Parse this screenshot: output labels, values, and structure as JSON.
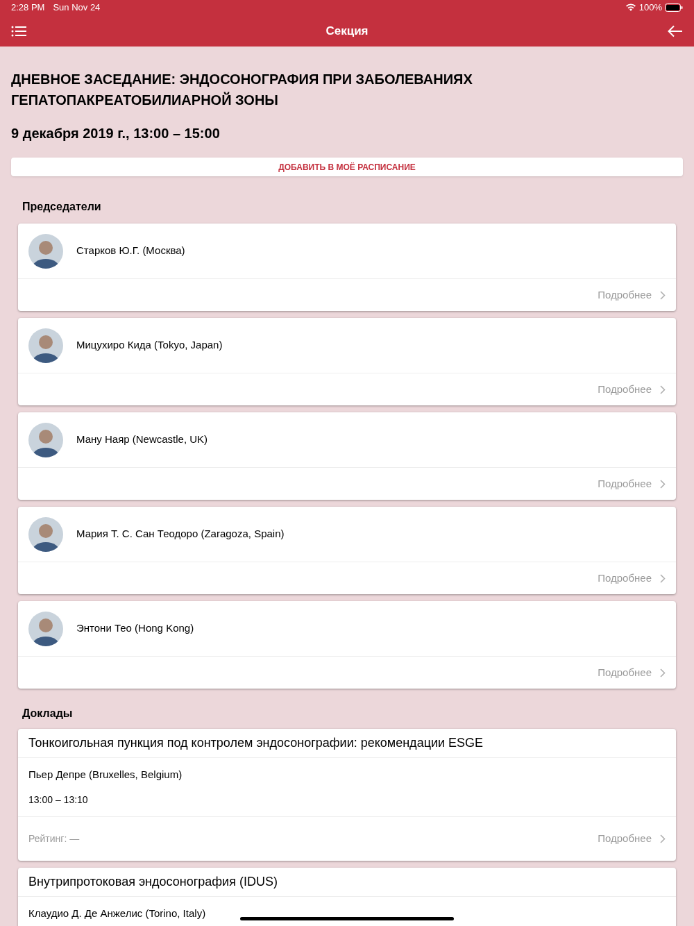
{
  "status_bar": {
    "time": "2:28 PM",
    "date": "Sun Nov 24",
    "battery": "100%"
  },
  "nav": {
    "title": "Секция"
  },
  "session": {
    "title": "ДНЕВНОЕ ЗАСЕДАНИЕ: ЭНДОСОНОГРАФИЯ ПРИ ЗАБОЛЕВАНИЯХ ГЕПАТОПАКРЕАТОБИЛИАРНОЙ ЗОНЫ",
    "datetime": "9 декабря 2019 г., 13:00 – 15:00",
    "add_button": "ДОБАВИТЬ В МОЁ РАСПИСАНИЕ"
  },
  "chairs": {
    "heading": "Председатели",
    "items": [
      {
        "name": "Старков Ю.Г. (Москва)",
        "more": "Подробнее"
      },
      {
        "name": "Мицухиро Кида (Tokyo, Japan)",
        "more": "Подробнее"
      },
      {
        "name": "Ману Наяр (Newcastle, UK)",
        "more": "Подробнее"
      },
      {
        "name": "Мария Т. С. Сан Теодоро (Zaragoza, Spain)",
        "more": "Подробнее"
      },
      {
        "name": "Энтони Тео (Hong Kong)",
        "more": "Подробнее"
      }
    ]
  },
  "talks": {
    "heading": "Доклады",
    "items": [
      {
        "title": "Тонкоигольная пункция под контролем эндосонографии: рекомендации ESGE",
        "speaker": "Пьер Депре (Bruxelles, Belgium)",
        "time": "13:00 – 13:10",
        "rating": "Рейтинг: —",
        "more": "Подробнее"
      },
      {
        "title": "Внутрипротоковая эндосонография (IDUS)",
        "speaker": "Клаудио Д. Де Анжелис (Torino, Italy)"
      }
    ]
  }
}
